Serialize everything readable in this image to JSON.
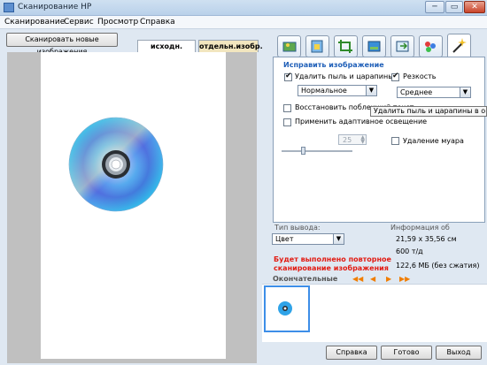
{
  "window": {
    "title": "Сканирование HP",
    "minimize": "─",
    "maximize": "▭",
    "close": "✕"
  },
  "menu": [
    "Сканирование",
    "Сервис",
    "Просмотр",
    "Справка"
  ],
  "toolbar": {
    "scan_new_label": "Сканировать новые изображения"
  },
  "tabs": [
    {
      "label": "исходн. изобр.",
      "active": true
    },
    {
      "label": "отдельн.изобр.",
      "active": false
    }
  ],
  "panel_icons": [
    "image-type-icon",
    "resize-icon",
    "crop-icon",
    "adjust-icon",
    "export-icon",
    "color-icon",
    "fix-image-icon"
  ],
  "fix_panel": {
    "heading": "Исправить изображение",
    "remove_dust": {
      "label": "Удалить пыль и царапины",
      "checked": true
    },
    "dust_level": "Нормальное",
    "sharpness": {
      "label": "Резкость",
      "checked": true
    },
    "sharpness_level": "Среднее",
    "restore_text": {
      "label": "Восстановить поблекший текст",
      "checked": false
    },
    "adaptive_light": {
      "label": "Применить адаптивное освещение",
      "checked": false
    },
    "moire": {
      "label": "Удаление муара",
      "checked": false
    },
    "spin_value": "25",
    "tooltip": "Удалить пыль и царапины в оконч"
  },
  "output": {
    "type_label": "Тип вывода:",
    "type_value": "Цвет",
    "info_label": "Информация об",
    "size": "21,59 x 35,56 см",
    "dpi": "600 т/д",
    "filesize": "122,6 МБ (без сжатия)",
    "warning_line1": "Будет выполнено повторное",
    "warning_line2": "сканирование изображения",
    "final_label": "Окончательные",
    "nav": [
      "◀◀",
      "◀",
      "▶",
      "▶▶"
    ]
  },
  "buttons": {
    "help": "Справка",
    "done": "Готово",
    "exit": "Выход"
  }
}
